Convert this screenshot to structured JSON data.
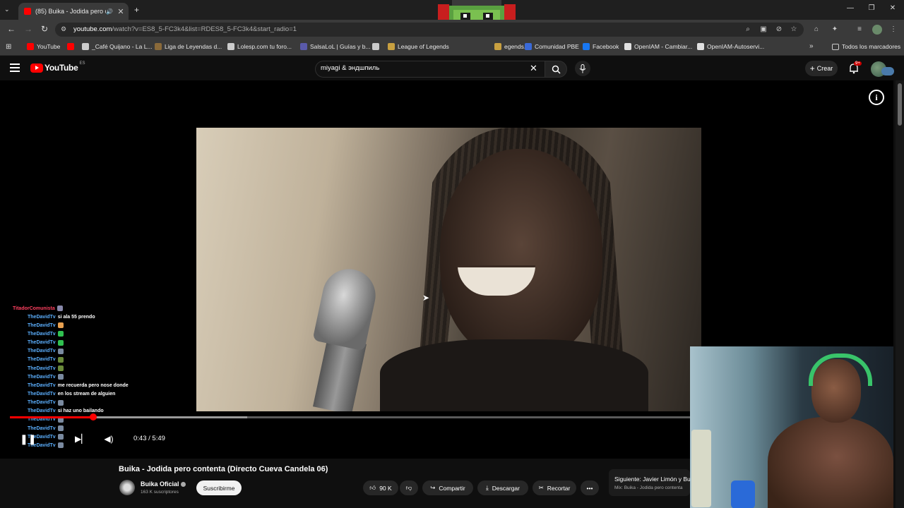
{
  "browser": {
    "tab_title": "(85) Buika - Jodida pero con",
    "url_host": "youtube.com",
    "url_path": "/watch?v=ES8_5-FC3k4&list=RDES8_5-FC3k4&start_radio=1",
    "bookmarks": [
      {
        "label": "YouTube",
        "color": "#ff0000"
      },
      {
        "label": "",
        "color": "#ff0000"
      },
      {
        "label": "_Café Quijano - La L...",
        "color": "#cccccc"
      },
      {
        "label": "Liga de Leyendas d...",
        "color": "#8a6a3a"
      },
      {
        "label": "Lolesp.com tu foro...",
        "color": "#cccccc"
      },
      {
        "label": "SalsaLoL | Guías y b...",
        "color": "#5a5aaa"
      },
      {
        "label": "",
        "color": "#cccccc"
      },
      {
        "label": "League of Legends",
        "color": "#c8a040"
      },
      {
        "label": "egends...",
        "color": "#c8a040"
      },
      {
        "label": "Comunidad PBE",
        "color": "#3a6ad8"
      },
      {
        "label": "Facebook",
        "color": "#1877f2"
      },
      {
        "label": "OpenIAM - Cambiar...",
        "color": "#e0e0e0"
      },
      {
        "label": "OpenIAM-Autoservi...",
        "color": "#e0e0e0"
      }
    ],
    "all_bookmarks": "Todos los marcadores"
  },
  "youtube": {
    "logo_text": "YouTube",
    "country_code": "ES",
    "search_query": "miyagi & эндшпиль",
    "create_label": "Crear",
    "notification_count": "9+"
  },
  "chat": [
    {
      "user": "TitadorComunista",
      "msg": "",
      "emote": "#8888aa"
    },
    {
      "user": "TheDavidTv",
      "msg": "si ala 55 prendo",
      "emote": ""
    },
    {
      "user": "TheDavidTv",
      "msg": "",
      "emote": "#e8a050"
    },
    {
      "user": "TheDavidTv",
      "msg": "",
      "emote": "#30c050"
    },
    {
      "user": "TheDavidTv",
      "msg": "",
      "emote": "#30c050"
    },
    {
      "user": "TheDavidTv",
      "msg": "",
      "emote": "#7a8aa0"
    },
    {
      "user": "TheDavidTv",
      "msg": "",
      "emote": "#6a8a3a"
    },
    {
      "user": "TheDavidTv",
      "msg": "",
      "emote": "#6a8a3a"
    },
    {
      "user": "TheDavidTv",
      "msg": "",
      "emote": "#7a8aa0"
    },
    {
      "user": "TheDavidTv",
      "msg": "me recuerda pero nose donde",
      "emote": ""
    },
    {
      "user": "TheDavidTv",
      "msg": "en los stream de alguien",
      "emote": ""
    },
    {
      "user": "TheDavidTv",
      "msg": "",
      "emote": "#7a8aa0"
    },
    {
      "user": "TheDavidTv",
      "msg": "si haz uno bailando",
      "emote": ""
    },
    {
      "user": "TheDavidTv",
      "msg": "",
      "emote": "#7a8aa0"
    },
    {
      "user": "TheDavidTv",
      "msg": "",
      "emote": "#7a8aa0"
    },
    {
      "user": "TheDavidTv",
      "msg": "",
      "emote": "#7a8aa0"
    },
    {
      "user": "TheDavidTv",
      "msg": "",
      "emote": "#7a8aa0"
    }
  ],
  "player": {
    "time": "0:43 / 5:49",
    "progress_fraction": 0.123,
    "buffered_fraction": 0.349
  },
  "video": {
    "title": "Buika - Jodida pero contenta (Directo Cueva Candela 06)",
    "channel": "Buika Oficial",
    "subscribers": "163 K suscriptores",
    "subscribe_label": "Suscribirme",
    "likes": "90 K",
    "share_label": "Compartir",
    "download_label": "Descargar",
    "clip_label": "Recortar",
    "more_label": "•••",
    "next_label": "Siguiente: Javier Limón y Bu",
    "next_sub": "Mix: Buika - Jodida pero contenta"
  },
  "icons": {
    "menu": "hamburger-icon",
    "search": "search-icon",
    "mic": "microphone-icon",
    "bell": "bell-icon",
    "info": "info-icon"
  }
}
